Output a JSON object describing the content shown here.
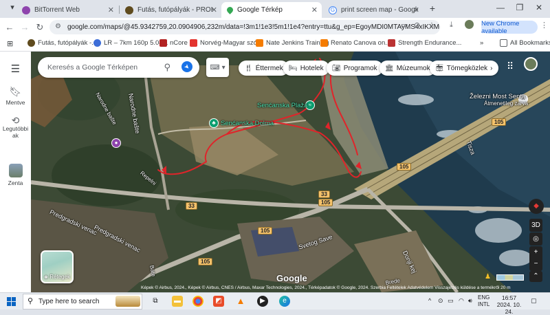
{
  "browser": {
    "tabs": [
      {
        "title": "BitTorrent Web",
        "active": false
      },
      {
        "title": "Futás, futópályák - PROHARDVER!",
        "active": false
      },
      {
        "title": "Google Térkép",
        "active": true
      },
      {
        "title": "print screen map - Google-keresés",
        "active": false
      }
    ],
    "new_tab": "+",
    "url": "google.com/maps/@45.9342759,20.0904906,232m/data=!3m1!1e3!5m1!1e4?entry=ttu&g_ep=EgoyMDI0MTAyMS4xIKXMDSoASAFQAw%3D%3D",
    "update_button": "New Chrome available",
    "bookmarks": [
      {
        "label": "Futás, futópályák -...",
        "color": "#5f4b1e"
      },
      {
        "label": "LR – 7km 160p 5.08...",
        "color": "#3d6ed8"
      },
      {
        "label": "nCore",
        "color": "#b22222"
      },
      {
        "label": "Norvég-Magyar szó...",
        "color": "#e3342f"
      },
      {
        "label": "Nate Jenkins Training",
        "color": "#f57c00"
      },
      {
        "label": "Renato Canova on...",
        "color": "#f57c00"
      },
      {
        "label": "Strength Endurance...",
        "color": "#b33"
      }
    ],
    "bookmarks_more": "»",
    "all_bookmarks": "All Bookmarks"
  },
  "rail": {
    "menu_icon": "menu-icon",
    "items": [
      {
        "label": "Mentve",
        "icon": "bookmark-icon"
      },
      {
        "label": "Legutóbbiak",
        "icon": "history-icon"
      },
      {
        "label": "Zenta",
        "icon": "place-thumbnail"
      }
    ]
  },
  "map": {
    "search_placeholder": "Keresés a Google Térképen",
    "chips": [
      {
        "label": "Éttermek",
        "icon": "restaurant-icon"
      },
      {
        "label": "Hotelek",
        "icon": "hotel-icon"
      },
      {
        "label": "Programok",
        "icon": "camera-icon"
      },
      {
        "label": "Múzeumok",
        "icon": "museum-icon"
      },
      {
        "label": "Tömegközlek",
        "icon": "transit-icon"
      }
    ],
    "labels": {
      "bridge": "Železni Most Senta",
      "bridge_sub": "Átmenetileg zárva",
      "beach": "Senćanska Plaža",
      "dolma": "Senćanska Dolma",
      "narodne_baste": "Narodne bašte",
      "narodne_baste2": "Narodne bašte",
      "predgradski1": "Predgradski venac",
      "predgradski2": "Predgradski venac",
      "svetog_save": "Svetog Save",
      "doni_kej": "Donji kej",
      "tisza": "Tisza",
      "bate": "Bate",
      "repelni": "Repelni",
      "brede": "Brede"
    },
    "shields": [
      "105",
      "105",
      "33",
      "33",
      "105",
      "105",
      "105"
    ],
    "layers_label": "Rétegek",
    "google_logo": "Google",
    "attribution": "Képek © Airbus, 2024., Képek © Airbus, CNES / Airbus, Maxar Technologies, 2024., Térképadatok © Google, 2024.   Szerbia   Feltételek   Adatvédelem   Visszajelzés küldése a termékről   20 m",
    "controls": {
      "compass": "compass-icon",
      "view3d": "3D",
      "locate": "locate-icon",
      "zoom_in": "+",
      "zoom_out": "−",
      "expand": "⌃"
    }
  },
  "taskbar": {
    "search_placeholder": "Type here to search",
    "lang1": "ENG",
    "lang2": "INTL",
    "time": "16:57",
    "date": "2024. 10. 24."
  }
}
